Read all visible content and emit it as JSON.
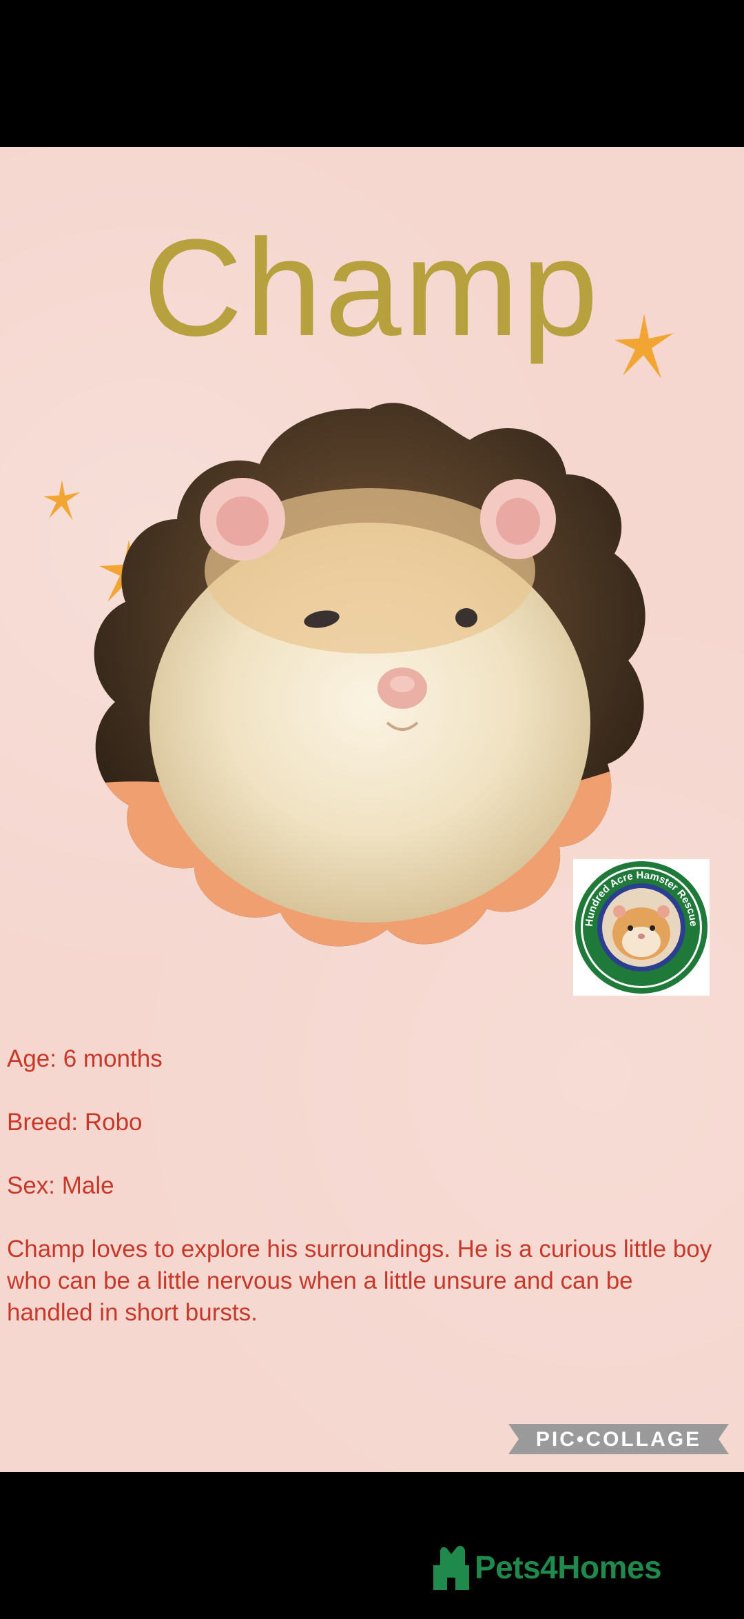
{
  "profile": {
    "name": "Champ",
    "age": "Age: 6 months",
    "breed": "Breed: Robo",
    "sex": "Sex: Male",
    "description": "Champ loves to explore his surroundings. He is a curious little boy who can be a little nervous when a little unsure and can be handled in short bursts."
  },
  "badge": {
    "text": "Hundred Acre Hamster Rescue"
  },
  "watermark": {
    "text": "PIC•COLLAGE"
  },
  "footer": {
    "brand": "Pets4Homes"
  },
  "colors": {
    "background": "#f5d7cf",
    "title": "#b7a03e",
    "body_text": "#c8382a",
    "star": "#f2a533",
    "brand_green": "#1f8a4c"
  },
  "icons": [
    "sparkle-star-icon",
    "hamster-photo",
    "rescue-badge-logo",
    "pets4homes-logo-icon"
  ]
}
